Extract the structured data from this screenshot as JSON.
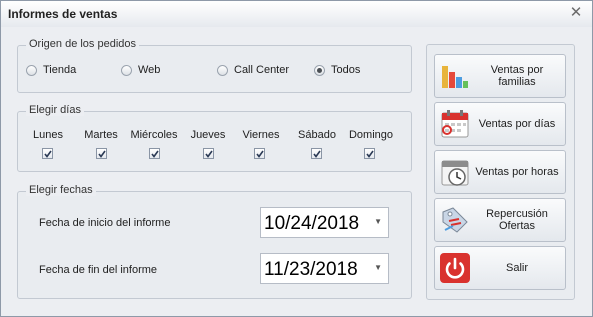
{
  "window": {
    "title": "Informes de ventas",
    "close_label": "✕"
  },
  "origen": {
    "legend": "Origen de los pedidos",
    "options": [
      {
        "label": "Tienda",
        "checked": false
      },
      {
        "label": "Web",
        "checked": false
      },
      {
        "label": "Call Center",
        "checked": false
      },
      {
        "label": "Todos",
        "checked": true
      }
    ]
  },
  "dias": {
    "legend": "Elegir días",
    "days": [
      {
        "label": "Lunes",
        "checked": true
      },
      {
        "label": "Martes",
        "checked": true
      },
      {
        "label": "Miércoles",
        "checked": true
      },
      {
        "label": "Jueves",
        "checked": true
      },
      {
        "label": "Viernes",
        "checked": true
      },
      {
        "label": "Sábado",
        "checked": true
      },
      {
        "label": "Domingo",
        "checked": true
      }
    ]
  },
  "fechas": {
    "legend": "Elegir fechas",
    "inicio_label": "Fecha de inicio del informe",
    "inicio_value": "10/24/2018",
    "fin_label": "Fecha de fin del informe",
    "fin_value": "11/23/2018"
  },
  "actions": {
    "familias": {
      "label": "Ventas por familias",
      "icon": "bar-chart-icon"
    },
    "dias": {
      "label": "Ventas por días",
      "icon": "calendar-icon"
    },
    "horas": {
      "label": "Ventas por horas",
      "icon": "clock-icon"
    },
    "ofertas": {
      "label": "Repercusión Ofertas",
      "icon": "price-tag-icon"
    },
    "salir": {
      "label": "Salir",
      "icon": "power-icon"
    }
  },
  "colors": {
    "accent_red": "#d9322e",
    "window_bg": "#eceef2"
  }
}
